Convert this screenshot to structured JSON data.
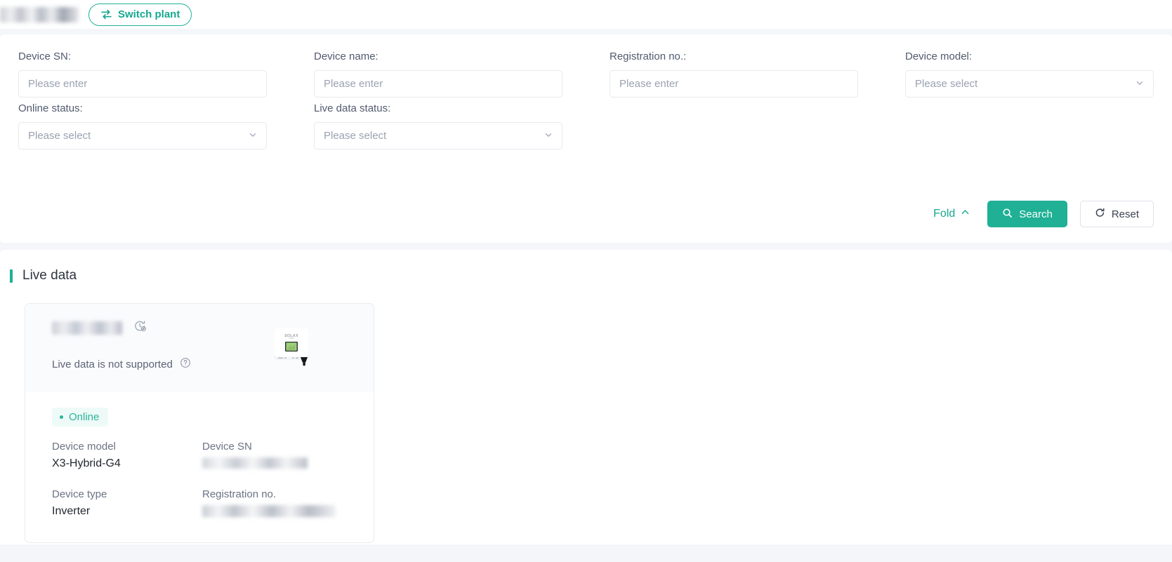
{
  "topbar": {
    "plant_name": "",
    "switch_plant_label": "Switch plant",
    "switch_plant_icon": "swap-arrows-icon"
  },
  "search_form": {
    "fields": [
      {
        "label": "Device SN:",
        "placeholder": "Please enter",
        "type": "input",
        "value": ""
      },
      {
        "label": "Device name:",
        "placeholder": "Please enter",
        "type": "input",
        "value": ""
      },
      {
        "label": "Registration no.:",
        "placeholder": "Please enter",
        "type": "input",
        "value": ""
      },
      {
        "label": "Device model:",
        "placeholder": "Please select",
        "type": "select",
        "value": ""
      },
      {
        "label": "Online status:",
        "placeholder": "Please select",
        "type": "select",
        "value": ""
      },
      {
        "label": "Live data status:",
        "placeholder": "Please select",
        "type": "select",
        "value": ""
      }
    ],
    "fold_label": "Fold",
    "fold_icon": "chevron-up-icon",
    "search_label": "Search",
    "search_icon": "search-icon",
    "reset_label": "Reset",
    "reset_icon": "refresh-icon"
  },
  "live_data": {
    "section_title": "Live data",
    "card": {
      "device_name": "",
      "history_icon": "history-clock-icon",
      "unsupported_text": "Live data is not supported",
      "help_icon": "question-circle-icon",
      "device_image": "solax-inverter-image",
      "device_image_logo": "SOLAX",
      "status_label": "Online",
      "details": [
        {
          "label": "Device model",
          "value": "X3-Hybrid-G4",
          "masked": false
        },
        {
          "label": "Device SN",
          "value": "",
          "masked": true
        },
        {
          "label": "Device type",
          "value": "Inverter",
          "masked": false
        },
        {
          "label": "Registration no.",
          "value": "",
          "masked": true
        }
      ]
    }
  },
  "colors": {
    "accent": "#1fb095",
    "accent_text": "#16a88f",
    "page_bg": "#f4f6f9",
    "label": "#515a6e",
    "placeholder": "#9aa2b1",
    "status_online": "#29b69c"
  }
}
